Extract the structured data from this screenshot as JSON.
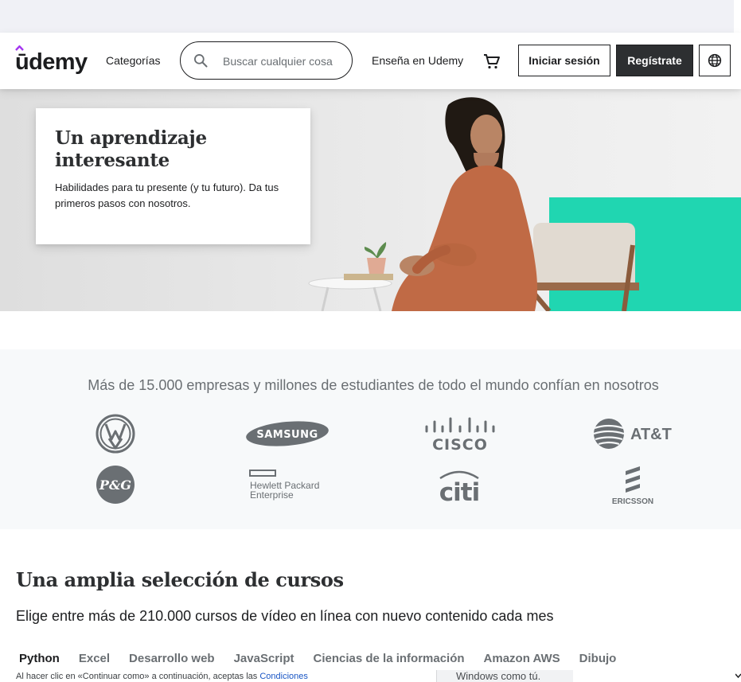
{
  "header": {
    "logo_text": "ūdemy",
    "categories": "Categorías",
    "search_placeholder": "Buscar cualquier cosa",
    "teach": "Enseña en Udemy",
    "login": "Iniciar sesión",
    "signup": "Regístrate"
  },
  "hero": {
    "title": "Un aprendizaje interesante",
    "text": "Habilidades para tu presente (y tu futuro). Da tus primeros pasos con nosotros."
  },
  "trust": {
    "title": "Más de 15.000 empresas y millones de estudiantes de todo el mundo confían en nosotros",
    "logos": [
      "VW",
      "SAMSUNG",
      "CISCO",
      "AT&T",
      "P&G",
      "Hewlett Packard",
      "Enterprise",
      "citi",
      "ERICSSON"
    ]
  },
  "courses": {
    "title": "Una amplia selección de cursos",
    "subtitle": "Elige entre más de 210.000 cursos de vídeo en línea con nuevo contenido cada mes",
    "tabs": [
      "Python",
      "Excel",
      "Desarrollo web",
      "JavaScript",
      "Ciencias de la información",
      "Amazon AWS",
      "Dibujo"
    ]
  },
  "cookie": {
    "text": "Al hacer clic en «Continuar como» a continuación, aceptas las ",
    "link": "Condiciones"
  },
  "popup": {
    "text": "Windows como tú."
  },
  "colors": {
    "brand_purple": "#a435f0",
    "dark": "#2d2f31",
    "teal": "#20d6b1",
    "link": "#1a56c5"
  }
}
